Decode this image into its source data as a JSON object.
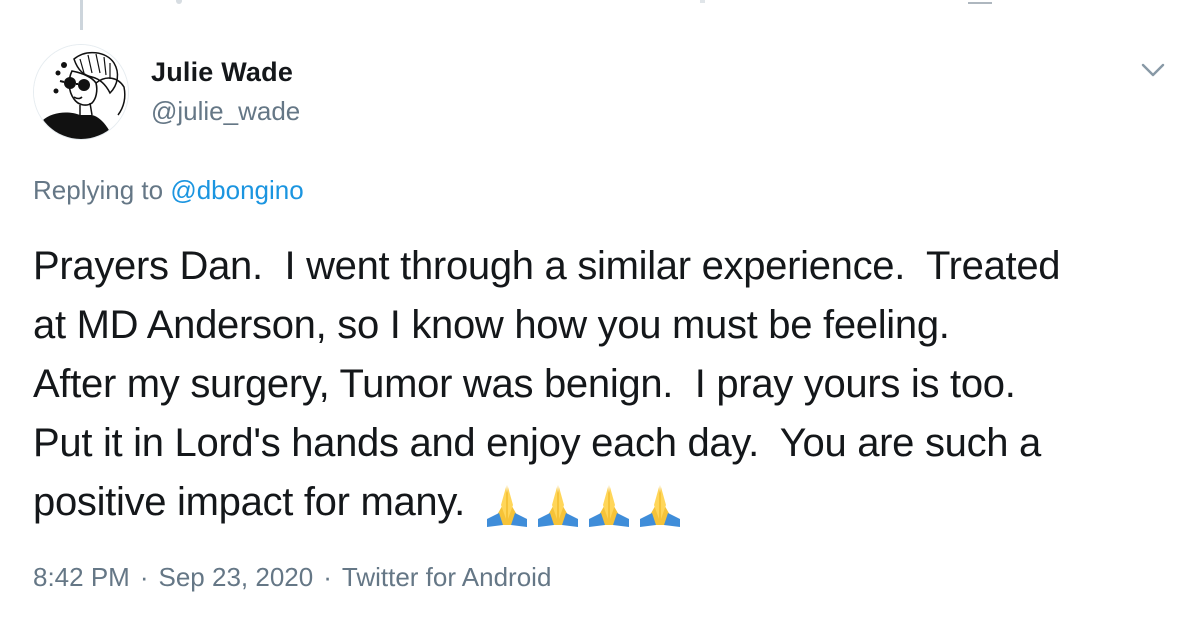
{
  "colors": {
    "text": "#14171a",
    "secondary": "#657786",
    "link": "#1b95e0",
    "thread_line": "#cdd5dc"
  },
  "author": {
    "name": "Julie Wade",
    "handle": "@julie_wade",
    "avatar_icon": "avatar-illustration-icon"
  },
  "reply": {
    "prefix": "Replying to",
    "mention": "@dbongino"
  },
  "tweet": {
    "lines": [
      "Prayers Dan.  I went through a similar experience.  Treated",
      "at MD Anderson, so I know how you must be feeling.",
      "After my surgery, Tumor was benign.  I pray yours is too.",
      "Put it in Lord's hands and enjoy each day.  You are such a",
      "positive impact for many."
    ],
    "emojis": [
      "🙏",
      "🙏",
      "🙏",
      "🙏"
    ]
  },
  "meta": {
    "time": "8:42 PM",
    "date": "Sep 23, 2020",
    "source": "Twitter for Android",
    "separator": "·"
  },
  "menu": {
    "icon": "chevron-down-icon"
  }
}
